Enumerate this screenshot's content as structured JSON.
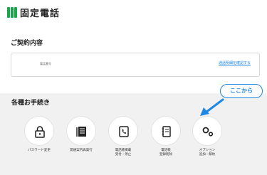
{
  "header": {
    "title": "固定電話",
    "logo_icon": "phone-bars-icon"
  },
  "contract": {
    "title": "ご契約内容",
    "label": "電話番号",
    "link": "通話明細を確認する"
  },
  "procedures": {
    "title": "各種お手続き",
    "callout": "ここから",
    "items": [
      {
        "label": "パスワード変更",
        "icon": "lock-icon"
      },
      {
        "label": "開通案内再発行",
        "icon": "document-icon"
      },
      {
        "label": "電話帳掲載\n受付・停止",
        "icon": "phonebook-icon"
      },
      {
        "label": "電話帳\n登録削除",
        "icon": "book-icon"
      },
      {
        "label": "オプション\n追加・解約",
        "icon": "options-icon"
      }
    ]
  },
  "colors": {
    "accent": "#1e88e5",
    "brand": "#1aa64a",
    "panel": "#f1f1f1"
  }
}
